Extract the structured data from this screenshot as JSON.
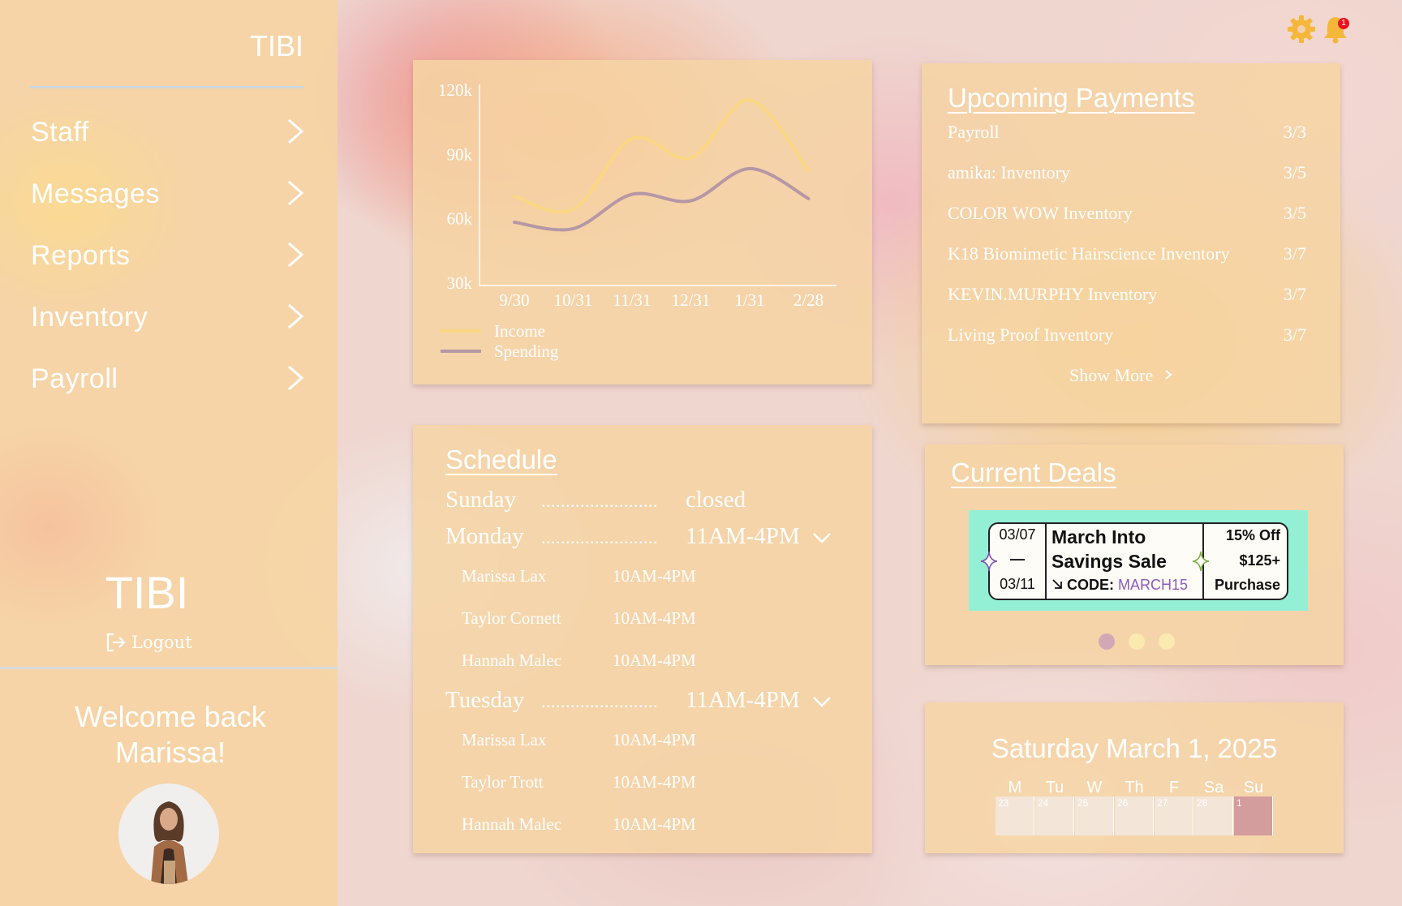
{
  "sidebar": {
    "title": "TIBI",
    "nav": [
      {
        "label": "Staff"
      },
      {
        "label": "Messages"
      },
      {
        "label": "Reports"
      },
      {
        "label": "Inventory"
      },
      {
        "label": "Payroll"
      }
    ],
    "brand": "TIBI",
    "logout_label": "Logout",
    "welcome_line1": "Welcome back",
    "welcome_line2": "Marissa!"
  },
  "topbar": {
    "settings_icon": "gear-icon",
    "notifications_icon": "bell-icon",
    "notification_count": "1",
    "accent_color": "#f5b73a"
  },
  "chart_data": {
    "type": "line",
    "x": [
      "9/30",
      "10/31",
      "11/31",
      "12/31",
      "1/31",
      "2/28"
    ],
    "yticks": [
      "120k",
      "90k",
      "60k",
      "30k"
    ],
    "ylim": [
      30000,
      120000
    ],
    "series": [
      {
        "name": "Income",
        "color": "#fbd782",
        "values": [
          70000,
          64000,
          97000,
          88000,
          115000,
          82000
        ]
      },
      {
        "name": "Spending",
        "color": "#b597a6",
        "values": [
          58000,
          55000,
          71000,
          68000,
          83000,
          69000
        ]
      }
    ],
    "legend_position": "bottom-left",
    "grid": false
  },
  "payments": {
    "title": "Upcoming Payments",
    "items": [
      {
        "name": "Payroll",
        "date": "3/3"
      },
      {
        "name": "amika: Inventory",
        "date": "3/5"
      },
      {
        "name": "COLOR WOW Inventory",
        "date": "3/5"
      },
      {
        "name": "K18 Biomimetic Hairscience Inventory",
        "date": "3/7"
      },
      {
        "name": "KEVIN.MURPHY Inventory",
        "date": "3/7"
      },
      {
        "name": "Living Proof Inventory",
        "date": "3/7"
      }
    ],
    "show_more": "Show More"
  },
  "schedule": {
    "title": "Schedule",
    "dots": "........................",
    "days": [
      {
        "day": "Sunday",
        "hours": "closed"
      },
      {
        "day": "Monday",
        "hours": "11AM-4PM",
        "staff": [
          {
            "name": "Marissa Lax",
            "hours": "10AM-4PM"
          },
          {
            "name": "Taylor Cornett",
            "hours": "10AM-4PM"
          },
          {
            "name": "Hannah Malec",
            "hours": "10AM-4PM"
          }
        ]
      },
      {
        "day": "Tuesday",
        "hours": "11AM-4PM",
        "staff": [
          {
            "name": "Marissa Lax",
            "hours": "10AM-4PM"
          },
          {
            "name": "Taylor Trott",
            "hours": "10AM-4PM"
          },
          {
            "name": "Hannah Malec",
            "hours": "10AM-4PM"
          }
        ]
      }
    ]
  },
  "deals": {
    "title": "Current Deals",
    "current": {
      "start": "03/07",
      "dash": "—",
      "end": "03/11",
      "name_line1": "March Into",
      "name_line2": "Savings Sale",
      "code_label": "CODE:",
      "code": "MARCH15",
      "offer_line1": "15% Off",
      "offer_line2": "$125+",
      "offer_line3": "Purchase"
    },
    "active_index": 0,
    "count": 3,
    "ticket_color": "#94f0d5"
  },
  "calendar": {
    "date": "Saturday March 1, 2025",
    "weekdays": [
      "M",
      "Tu",
      "W",
      "Th",
      "F",
      "Sa",
      "Su"
    ],
    "days": [
      "23",
      "24",
      "25",
      "26",
      "27",
      "28",
      "1"
    ],
    "selected_index": 6,
    "selected_color": "#d39c9d"
  }
}
